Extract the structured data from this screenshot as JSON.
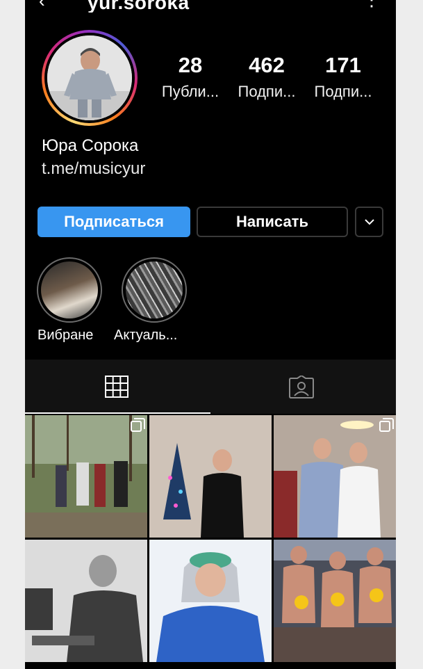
{
  "header": {
    "back_icon": "back-arrow-icon",
    "username": "yur.soroka",
    "more_icon": "more-vertical-icon"
  },
  "profile": {
    "stats": [
      {
        "value": "28",
        "label": "Публи..."
      },
      {
        "value": "462",
        "label": "Подпи..."
      },
      {
        "value": "171",
        "label": "Подпи..."
      }
    ],
    "name": "Юра Сорока",
    "link": "t.me/musicyur"
  },
  "actions": {
    "follow_label": "Подписаться",
    "message_label": "Написать",
    "dropdown_icon": "chevron-down-icon"
  },
  "highlights": [
    {
      "label": "Вибране"
    },
    {
      "label": "Актуаль..."
    }
  ],
  "tabs": {
    "grid_icon": "grid-icon",
    "tagged_icon": "tagged-user-icon",
    "active": "grid"
  },
  "colors": {
    "background": "#000000",
    "accent": "#3896f0",
    "text": "#ffffff"
  }
}
